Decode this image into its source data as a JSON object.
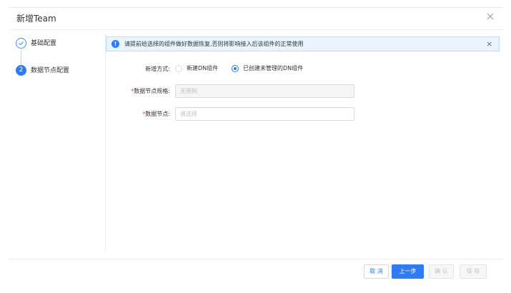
{
  "dialog": {
    "title": "新增Team"
  },
  "steps": [
    {
      "label": "基础配置",
      "status": "done"
    },
    {
      "number": "2",
      "label": "数据节点配置",
      "status": "active"
    }
  ],
  "alert": {
    "icon": "!",
    "text": "请提前给选择的组件做好数据恢复,否则将影响接入后该组件的正常使用",
    "close": "×"
  },
  "form": {
    "add_mode": {
      "label": "新增方式:",
      "options": [
        {
          "label": "新建DN组件",
          "checked": false
        },
        {
          "label": "已创建未管理的DN组件",
          "checked": true
        }
      ]
    },
    "node_spec": {
      "required_mark": "*",
      "label": "数据节点规格:",
      "value": "无限制"
    },
    "node": {
      "required_mark": "*",
      "label": "数据节点:",
      "placeholder": "请选择"
    }
  },
  "footer": {
    "cancel": "取 消",
    "prev": "上一步",
    "confirm": "确 认",
    "save": "保 存"
  },
  "colors": {
    "primary": "#2d7cf6",
    "required": "#f0443c",
    "alert_bg": "#e9f4ff"
  }
}
